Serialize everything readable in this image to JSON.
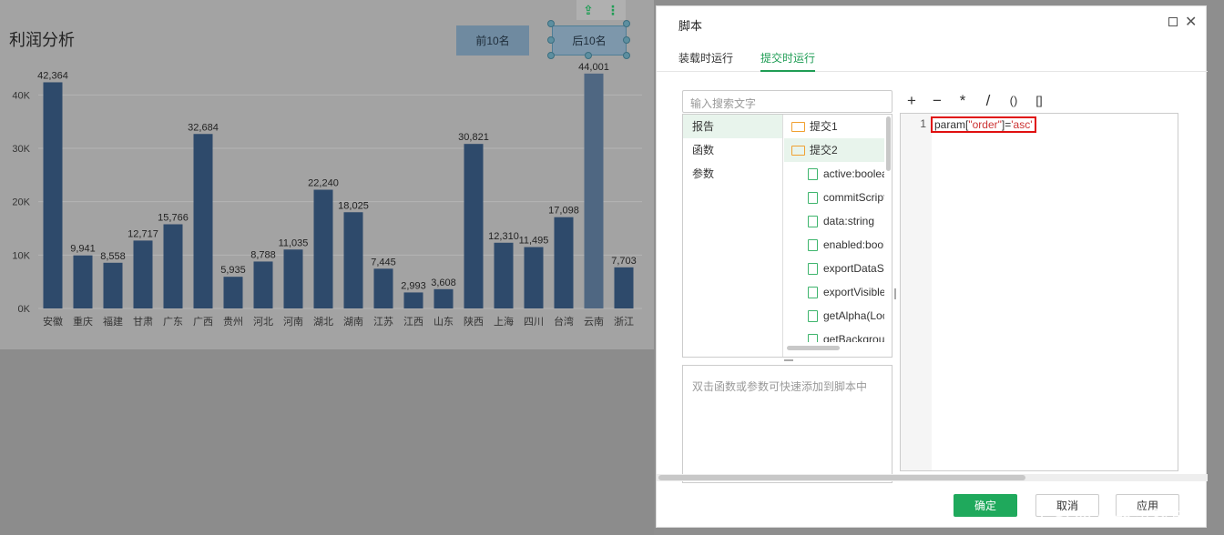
{
  "report": {
    "title": "利润分析",
    "buttons": {
      "top10": "前10名",
      "bottom10": "后10名"
    },
    "toolbar_icons": [
      "export-icon",
      "more-vertical-icon"
    ]
  },
  "chart_data": {
    "type": "bar",
    "categories": [
      "安徽",
      "重庆",
      "福建",
      "甘肃",
      "广东",
      "广西",
      "贵州",
      "河北",
      "河南",
      "湖北",
      "湖南",
      "江苏",
      "江西",
      "山东",
      "陕西",
      "上海",
      "四川",
      "台湾",
      "云南",
      "浙江"
    ],
    "values": [
      42364,
      9941,
      8558,
      12717,
      15766,
      32684,
      5935,
      8788,
      11035,
      22240,
      18025,
      7445,
      2993,
      3608,
      30821,
      12310,
      11495,
      17098,
      44001,
      7703
    ],
    "value_labels": [
      "42,364",
      "9,941",
      "8,558",
      "12,717",
      "15,766",
      "32,684",
      "5,935",
      "8,788",
      "11,035",
      "22,240",
      "18,025",
      "7,445",
      "2,993",
      "3,608",
      "30,821",
      "12,310",
      "11,495",
      "17,098",
      "44,001",
      "7,703"
    ],
    "yticks": [
      "0K",
      "10K",
      "20K",
      "30K",
      "40K"
    ],
    "ytick_values": [
      0,
      10000,
      20000,
      30000,
      40000
    ],
    "ylim": [
      0,
      45000
    ],
    "grid": true,
    "bar_color": "#2e4a6b",
    "highlight_color": "#4f6782"
  },
  "dialog": {
    "title": "脚本",
    "tabs": [
      "装载时运行",
      "提交时运行"
    ],
    "active_tab": 1,
    "search_placeholder": "输入搜索文字",
    "operators": [
      "+",
      "−",
      "*",
      "/",
      "()",
      "[]"
    ],
    "categories": [
      "报告",
      "函数",
      "参数"
    ],
    "tree": [
      {
        "label": "提交1",
        "type": "folder"
      },
      {
        "label": "提交2",
        "type": "folder"
      },
      {
        "label": "active:boolea",
        "type": "file"
      },
      {
        "label": "commitScript",
        "type": "file"
      },
      {
        "label": "data:string",
        "type": "file"
      },
      {
        "label": "enabled:bool",
        "type": "file"
      },
      {
        "label": "exportDataSh",
        "type": "file"
      },
      {
        "label": "exportVisible",
        "type": "file"
      },
      {
        "label": "getAlpha(Loc",
        "type": "file"
      },
      {
        "label": "getBackgrou",
        "type": "file"
      }
    ],
    "hint": "双击函数或参数可快速添加到脚本中",
    "editor": {
      "line_number": "1",
      "code": {
        "ident": "param[",
        "key": "\"order\"",
        "close": "]=",
        "value": "'asc'"
      }
    },
    "buttons": {
      "ok": "确定",
      "cancel": "取消",
      "apply": "应用"
    },
    "accent_color": "#1fa95c"
  },
  "watermark": "CSDN @永洪科技"
}
